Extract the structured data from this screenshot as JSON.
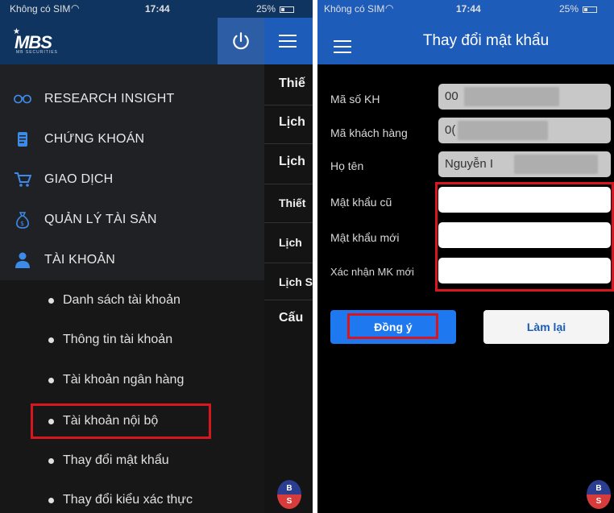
{
  "left_phone": {
    "status": {
      "carrier": "Không có SIM",
      "time": "17:44",
      "battery": "25%"
    },
    "logo": {
      "text": "MBS",
      "subtext": "MB SECURITIES"
    },
    "menu": [
      {
        "label": "RESEARCH INSIGHT",
        "icon": "glasses-icon"
      },
      {
        "label": "CHỨNG KHOÁN",
        "icon": "document-icon"
      },
      {
        "label": "GIAO DỊCH",
        "icon": "cart-icon"
      },
      {
        "label": "QUẢN LÝ TÀI SẢN",
        "icon": "money-bag-icon"
      },
      {
        "label": "TÀI KHOẢN",
        "icon": "user-icon"
      }
    ],
    "submenu": [
      "Danh sách tài khoản",
      "Thông tin tài khoản",
      "Tài khoản ngân hàng",
      "Tài khoản nội bộ",
      "Thay đổi mật khẩu",
      "Thay đổi kiểu xác thực"
    ],
    "background_items": [
      "Thiế",
      "Lịch",
      "Lịch",
      "Thiết",
      "Lịch",
      "Lịch S",
      "Cấu"
    ],
    "badge": {
      "top": "B",
      "bottom": "S"
    }
  },
  "right_phone": {
    "status": {
      "carrier": "Không có SIM",
      "time": "17:44",
      "battery": "25%"
    },
    "title": "Thay đổi mật khẩu",
    "fields": [
      {
        "label": "Mã số KH",
        "value": "00"
      },
      {
        "label": "Mã khách hàng",
        "value": "0("
      },
      {
        "label": "Họ tên",
        "value": "Nguyễn I"
      },
      {
        "label": "Mật khẩu cũ",
        "value": ""
      },
      {
        "label": "Mật khẩu mới",
        "value": ""
      },
      {
        "label": "Xác nhận MK mới",
        "value": ""
      }
    ],
    "buttons": {
      "confirm": "Đồng ý",
      "reset": "Làm lại"
    },
    "badge": {
      "top": "B",
      "bottom": "S"
    }
  },
  "colors": {
    "accent_blue": "#1e5cba",
    "drawer_bg": "#202124",
    "highlight_red": "#d9161e",
    "confirm_blue": "#1e78f0"
  }
}
